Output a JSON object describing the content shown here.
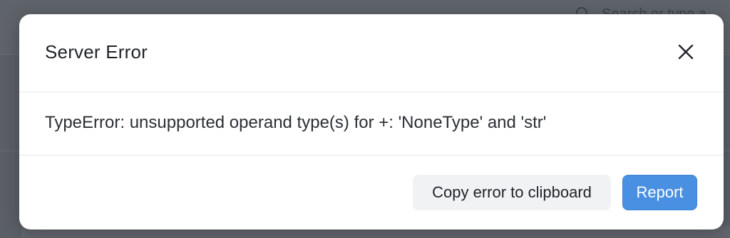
{
  "background": {
    "search_placeholder": "Search or type a"
  },
  "modal": {
    "title": "Server Error",
    "message": "TypeError: unsupported operand type(s) for +: 'NoneType' and 'str'",
    "buttons": {
      "copy_label": "Copy error to clipboard",
      "report_label": "Report"
    }
  },
  "icons": {
    "close": "close-icon",
    "search": "search-icon"
  },
  "colors": {
    "primary": "#4a90e2",
    "overlay": "#5b5f66",
    "secondary_button": "#f1f2f4"
  }
}
